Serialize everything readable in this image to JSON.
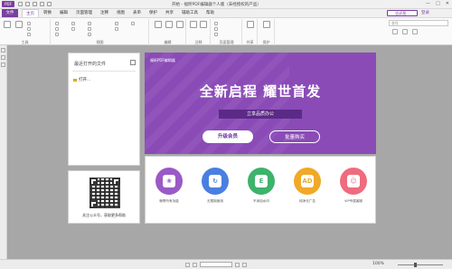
{
  "app": {
    "logo_text": "PDF",
    "window_title": "开始 - 福昕PDF编辑器个人版（未经授权的产品）",
    "window_controls": [
      "—",
      "□",
      "✕"
    ]
  },
  "menu": {
    "file_label": "文件",
    "tabs": [
      "主页",
      "转换",
      "编辑",
      "页面管理",
      "注释",
      "视图",
      "表单",
      "保护",
      "共享",
      "辅助工具",
      "帮助"
    ],
    "active_index": 0,
    "help_box": "告诉我...",
    "user_label": "登录"
  },
  "ribbon": {
    "groups": [
      {
        "label": "工具"
      },
      {
        "label": "视图"
      },
      {
        "label": "编辑"
      },
      {
        "label": "注释"
      },
      {
        "label": "页面管理"
      },
      {
        "label": "共享"
      },
      {
        "label": "保护"
      }
    ],
    "search_placeholder": "查找"
  },
  "recent": {
    "title": "最近打开的文件",
    "open_label": "打开..."
  },
  "qr": {
    "caption": "关注公众号，获取更多帮助"
  },
  "banner": {
    "small_text": "福昕PDF编辑器",
    "headline": "全新启程 耀世首发",
    "badge": "立享品质办公",
    "upgrade_button": "升级会员",
    "bulk_button": "批量购买"
  },
  "features": [
    {
      "label": "畅享所有功能",
      "color": "#9b59c6",
      "glyph": "❀"
    },
    {
      "label": "无限制使用",
      "color": "#4a7fe0",
      "glyph": "↻"
    },
    {
      "label": "不添加水印",
      "color": "#3db36b",
      "glyph": "E"
    },
    {
      "label": "纯净无广告",
      "color": "#f0a928",
      "glyph": "AD"
    },
    {
      "label": "VIP专属客服",
      "color": "#ef6b7e",
      "glyph": "☺"
    }
  ],
  "status": {
    "zoom": "100%"
  },
  "colors": {
    "brand": "#7b3fa0",
    "banner": "#8a4bb7"
  }
}
